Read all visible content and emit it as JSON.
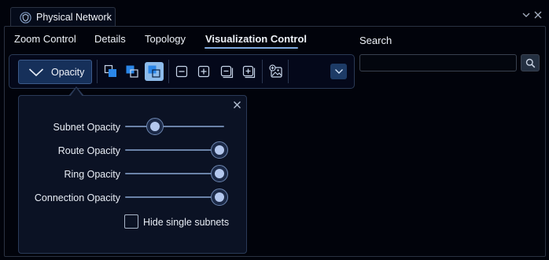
{
  "window": {
    "title": "Physical Network",
    "icon": "shield-network-icon",
    "controls": [
      "chevron-down-icon",
      "close-icon"
    ]
  },
  "tabs": [
    {
      "label": "Zoom Control",
      "active": false
    },
    {
      "label": "Details",
      "active": false
    },
    {
      "label": "Topology",
      "active": false
    },
    {
      "label": "Visualization Control",
      "active": true
    }
  ],
  "search": {
    "label": "Search",
    "value": "",
    "placeholder": "",
    "button_icon": "search-icon"
  },
  "toolbar": {
    "opacity_label": "Opacity",
    "opacity_icon": "chevron-down-icon",
    "icons": [
      {
        "name": "bring-to-front-icon",
        "selected": false
      },
      {
        "name": "send-backward-icon",
        "selected": false
      },
      {
        "name": "send-to-back-icon",
        "selected": true
      },
      {
        "name": "zoom-out-icon",
        "selected": false
      },
      {
        "name": "zoom-in-icon",
        "selected": false
      },
      {
        "name": "zoom-out-alt-icon",
        "selected": false
      },
      {
        "name": "zoom-in-alt-icon",
        "selected": false
      },
      {
        "name": "add-image-icon",
        "selected": false
      }
    ],
    "dropdown_icon": "chevron-down-icon"
  },
  "opacity_popup": {
    "close_icon": "close-icon",
    "sliders": [
      {
        "label": "Subnet Opacity",
        "value": 0.25
      },
      {
        "label": "Route Opacity",
        "value": 1.0
      },
      {
        "label": "Ring Opacity",
        "value": 1.0
      },
      {
        "label": "Connection Opacity",
        "value": 1.0
      }
    ],
    "checkbox": {
      "label": "Hide single subnets",
      "checked": false
    }
  },
  "colors": {
    "background": "#01030b",
    "accent": "#7fa9e0",
    "button_fill": "#16305a",
    "selected_icon": "#8dbbea",
    "popup_fill": "#0b1224"
  }
}
